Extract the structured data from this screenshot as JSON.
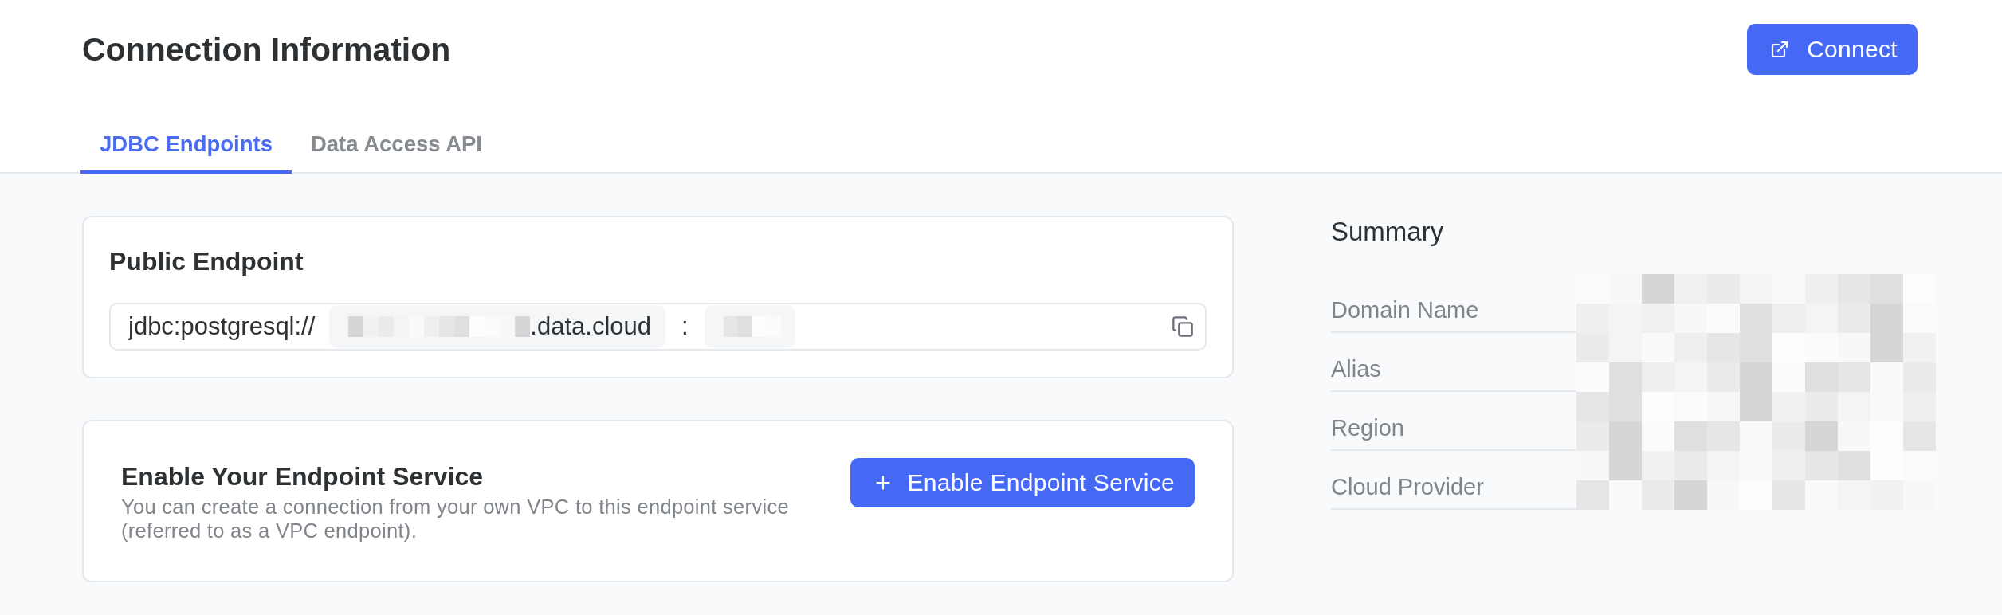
{
  "header": {
    "title": "Connection Information",
    "connect_button": {
      "label": "Connect"
    }
  },
  "tabs": [
    {
      "label": "JDBC Endpoints",
      "selected": true
    },
    {
      "label": "Data Access API",
      "selected": false
    }
  ],
  "public_endpoint": {
    "title": "Public Endpoint",
    "endpoint": {
      "scheme": "jdbc:postgresql://",
      "host": ".data.cloud",
      "host_redacted": true,
      "separator": ":",
      "port_redacted": true
    }
  },
  "endpoint_service": {
    "title": "Enable Your Endpoint Service",
    "description": "You can create a connection from your own VPC to this endpoint service (referred to as a VPC endpoint).",
    "button": {
      "label": "Enable Endpoint Service"
    }
  },
  "summary": {
    "title": "Summary",
    "rows": [
      {
        "label": "Domain Name",
        "value_redacted": true
      },
      {
        "label": "Alias",
        "value_redacted": true
      },
      {
        "label": "Region",
        "value_redacted": true
      },
      {
        "label": "Cloud Provider",
        "value_redacted": true
      }
    ]
  }
}
